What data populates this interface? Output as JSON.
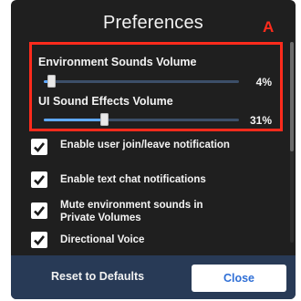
{
  "dialog": {
    "title": "Preferences",
    "annotation_label": "A",
    "colors": {
      "accent": "#5fa8ff",
      "annotation": "#ff2b1c",
      "footer": "#283a56",
      "background": "#1f1f1f"
    }
  },
  "volumes": [
    {
      "label": "Environment Sounds Volume",
      "value_text": "4%",
      "value": 0.04
    },
    {
      "label": "UI Sound Effects Volume",
      "value_text": "31%",
      "value": 0.31
    }
  ],
  "options": [
    {
      "label": "Enable user join/leave notification",
      "checked": true
    },
    {
      "label": "Enable text chat notifications",
      "checked": true
    },
    {
      "label": "Mute environment sounds in Private Volumes",
      "checked": true
    },
    {
      "label": "Directional Voice",
      "checked": true
    }
  ],
  "footer": {
    "reset_label": "Reset to Defaults",
    "close_label": "Close"
  }
}
